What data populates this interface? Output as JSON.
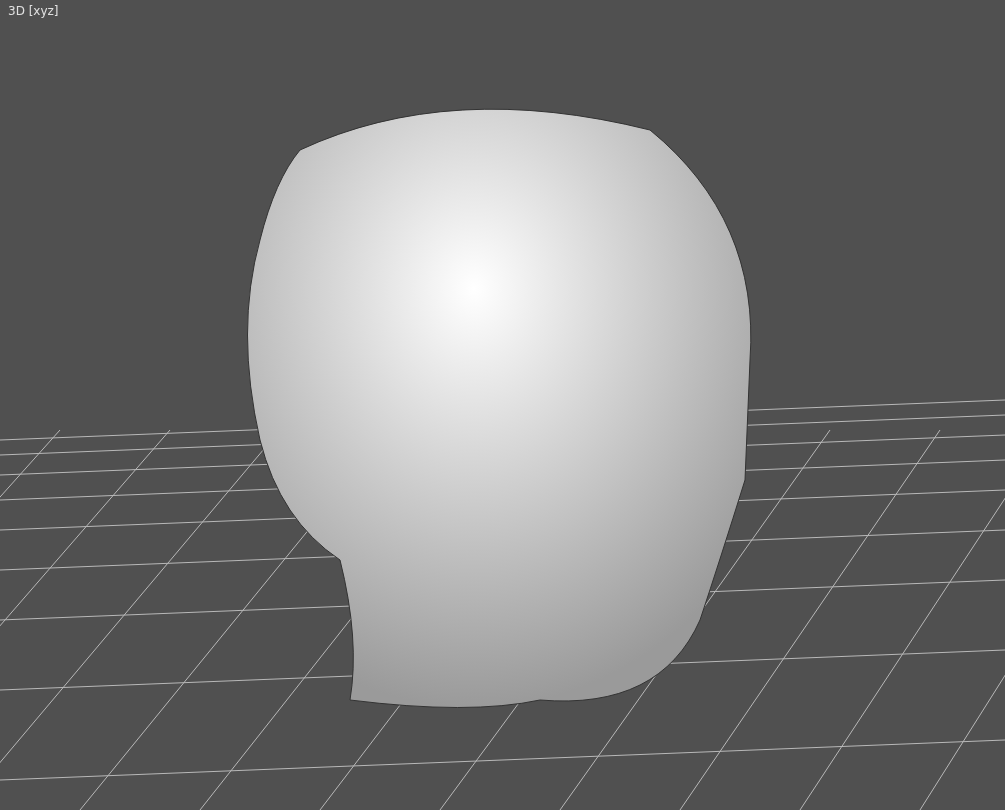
{
  "viewport": {
    "label": "3D [xyz]"
  }
}
